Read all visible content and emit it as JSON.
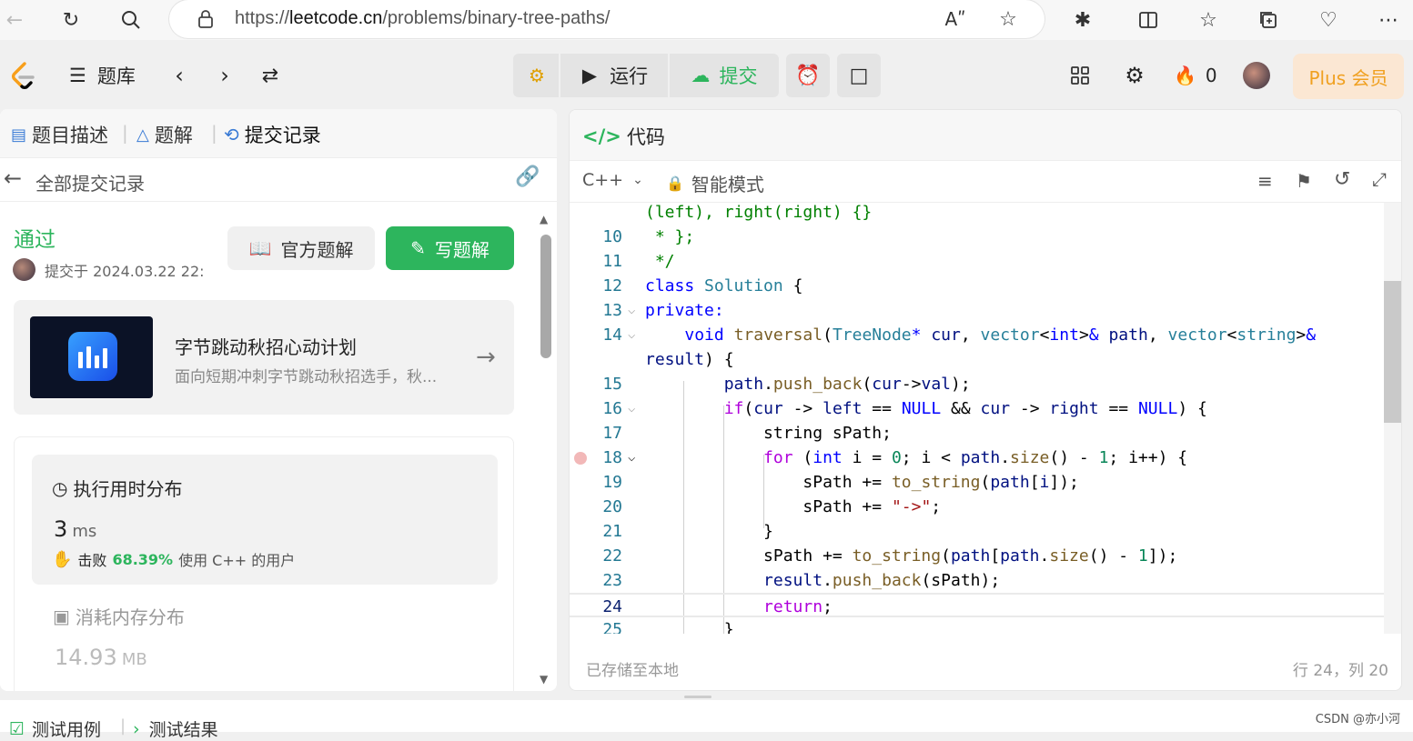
{
  "browser": {
    "url_prefix": "https://",
    "url_domain": "leetcode.cn",
    "url_path": "/problems/binary-tree-paths/"
  },
  "nav": {
    "problem_bank": "题库",
    "run": "运行",
    "submit": "提交",
    "flame_count": "0",
    "plus": "Plus 会员"
  },
  "left": {
    "tabs": [
      "题目描述",
      "题解",
      "提交记录"
    ],
    "back_label": "全部提交记录",
    "status": "通过",
    "submitted_at": "提交于 2024.03.22 22:",
    "official_solution": "官方题解",
    "write_solution": "写题解",
    "ad": {
      "title": "字节跳动秋招心动计划",
      "subtitle": "面向短期冲刺字节跳动秋招选手，秋..."
    },
    "runtime": {
      "title": "执行用时分布",
      "value": "3",
      "unit": "ms",
      "beat_label": "击败",
      "beat_pct": "68.39%",
      "beat_suffix": "使用 C++ 的用户"
    },
    "memory": {
      "title": "消耗内存分布",
      "value": "14.93",
      "unit": "MB"
    }
  },
  "right": {
    "header": "代码",
    "language": "C++",
    "mode": "智能模式",
    "footer_left": "已存储至本地",
    "footer_right": "行 24，列 20",
    "lines": [
      {
        "n": "",
        "html": "<span class=\"cm\">(left), right(right) {}</span>"
      },
      {
        "n": "10",
        "html": "<span class=\"cm\"> * };</span>"
      },
      {
        "n": "11",
        "html": "<span class=\"cm\"> */</span>"
      },
      {
        "n": "12",
        "html": "<span class=\"kw\">class</span> <span class=\"ty\">Solution</span> {"
      },
      {
        "n": "13",
        "html": "<span class=\"kw\">private:</span>"
      },
      {
        "n": "14",
        "html": "    <span class=\"kw\">void</span> <span class=\"fn\">traversal</span>(<span class=\"ty\">TreeNode</span><span class=\"kw\">*</span> <span class=\"var\">cur</span>, <span class=\"ty\">vector</span>&lt;<span class=\"kw\">int</span>&gt;<span class=\"kw\">&amp;</span> <span class=\"var\">path</span>, <span class=\"ty\">vector</span>&lt;<span class=\"ty\">string</span>&gt;<span class=\"kw\">&amp;</span>"
      },
      {
        "n": "",
        "html": "<span class=\"var\">result</span>) {"
      },
      {
        "n": "15",
        "html": "        <span class=\"var\">path</span>.<span class=\"fn\">push_back</span>(<span class=\"var\">cur</span>-&gt;<span class=\"var\">val</span>);"
      },
      {
        "n": "16",
        "html": "        <span class=\"kw2\">if</span>(<span class=\"var\">cur</span> -&gt; <span class=\"var\">left</span> == <span class=\"kw\">NULL</span> &amp;&amp; <span class=\"var\">cur</span> -&gt; <span class=\"var\">right</span> == <span class=\"kw\">NULL</span>) {"
      },
      {
        "n": "17",
        "html": "            string sPath;"
      },
      {
        "n": "18",
        "html": "            <span class=\"kw2\">for</span> (<span class=\"kw\">int</span> i = <span class=\"num\">0</span>; i &lt; <span class=\"var\">path</span>.<span class=\"fn\">size</span>() - <span class=\"num\">1</span>; i++) {"
      },
      {
        "n": "19",
        "html": "                sPath += <span class=\"fn\">to_string</span>(<span class=\"var\">path</span>[<span class=\"var\">i</span>]);"
      },
      {
        "n": "20",
        "html": "                sPath += <span class=\"str\">\"-&gt;\"</span>;"
      },
      {
        "n": "21",
        "html": "            }"
      },
      {
        "n": "22",
        "html": "            sPath += <span class=\"fn\">to_string</span>(<span class=\"var\">path</span>[<span class=\"var\">path</span>.<span class=\"fn\">size</span>() - <span class=\"num\">1</span>]);"
      },
      {
        "n": "23",
        "html": "            <span class=\"var\">result</span>.<span class=\"fn\">push_back</span>(sPath);"
      },
      {
        "n": "24",
        "html": "            <span class=\"kw2\">return</span>;"
      },
      {
        "n": "25",
        "html": "        }"
      }
    ]
  },
  "bottom": {
    "tab_testcase": "测试用例",
    "tab_result": "测试结果",
    "watermark": "CSDN @亦小河"
  }
}
